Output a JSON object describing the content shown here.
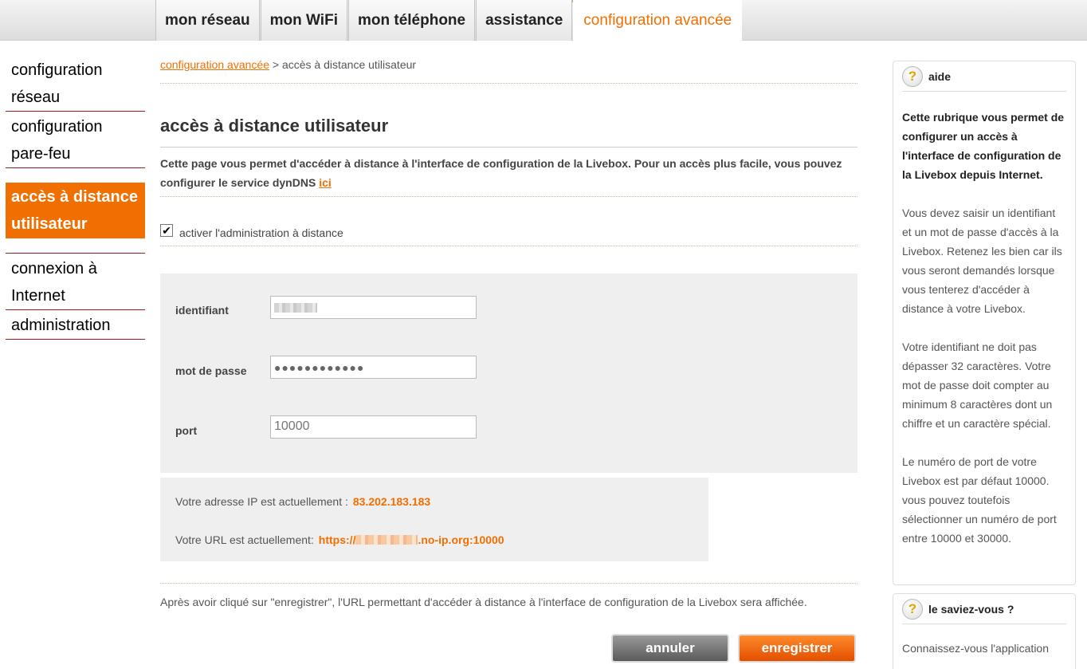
{
  "tabs": [
    {
      "label": "mon réseau"
    },
    {
      "label": "mon WiFi"
    },
    {
      "label": "mon téléphone"
    },
    {
      "label": "assistance"
    },
    {
      "label": "configuration avancée"
    }
  ],
  "sidebar": {
    "items": [
      {
        "label": "configuration réseau"
      },
      {
        "label": "configuration pare-feu"
      },
      {
        "label": "accès à distance utilisateur"
      },
      {
        "label": "connexion à Internet"
      },
      {
        "label": "administration"
      }
    ]
  },
  "breadcrumb": {
    "parent": "configuration avancée",
    "separator": " > ",
    "current": "accès à distance utilisateur"
  },
  "page": {
    "title": "accès à distance utilisateur",
    "description": "Cette page vous permet d'accéder à distance à l'interface de configuration de la Livebox. Pour un accès plus facile, vous pouvez configurer le service dynDNS ",
    "description_link": "ici"
  },
  "remote_admin": {
    "checkbox_label": "activer l'administration à distance",
    "checked_glyph": "✔"
  },
  "form": {
    "identifiant_label": "identifiant",
    "password_label": "mot de passe",
    "password_value": "●●●●●●●●●●●●",
    "port_label": "port",
    "port_value": "10000"
  },
  "info": {
    "ip_label": "Votre adresse IP est actuellement :",
    "ip_value": "83.202.183.183",
    "url_label": "Votre URL est actuellement:",
    "url_prefix": "https://",
    "url_suffix": ".no-ip.org:10000"
  },
  "footer_note": "Après avoir cliqué sur \"enregistrer\", l'URL permettant d'accéder à distance à l'interface de configuration de la Livebox sera affichée.",
  "buttons": {
    "cancel": "annuler",
    "save": "enregistrer"
  },
  "help": {
    "icon_glyph": "?",
    "title": "aide",
    "intro": "Cette rubrique vous permet de configurer un accès à l'interface de configuration de la Livebox depuis Internet.",
    "p1": "Vous devez saisir un identifiant et un mot de passe d'accès à la Livebox. Retenez les bien car ils vous seront demandés lorsque vous tenterez d'accéder à distance à votre Livebox.",
    "p2": "Votre identifiant ne doit pas dépasser 32 caractères. Votre mot de passe doit compter au minimum 8 caractères dont un chiffre et un caractère spécial.",
    "p3": "Le numéro de port de votre Livebox est par défaut 10000. vous pouvez toutefois sélectionner un numéro de port entre 10000 et 30000."
  },
  "tip": {
    "icon_glyph": "?",
    "title": "le saviez-vous ?",
    "text": "Connaissez-vous l'application"
  },
  "colors": {
    "accent": "#f16e00",
    "active_tab_text": "#f16e00",
    "sidebar_active_bg": "#f16e00"
  }
}
